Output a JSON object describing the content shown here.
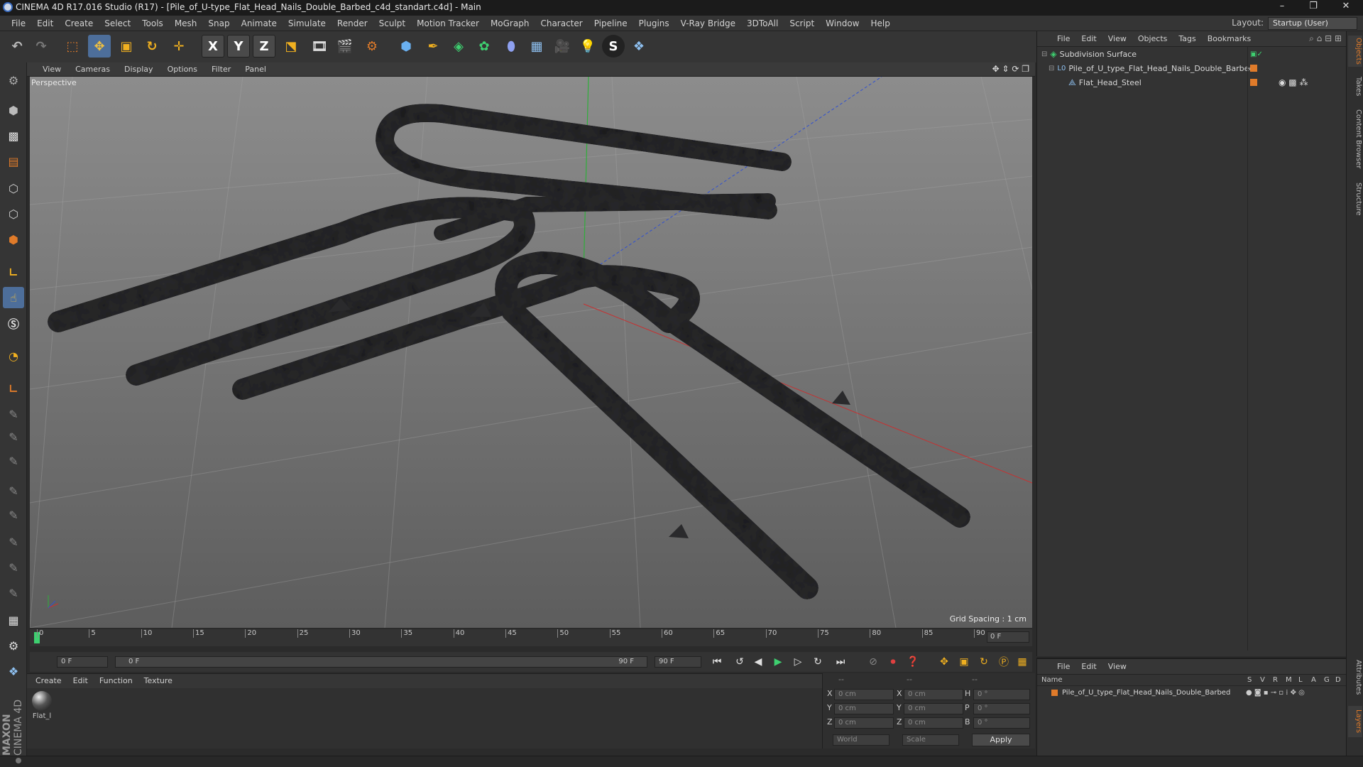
{
  "window": {
    "title": "CINEMA 4D R17.016 Studio (R17) - [Pile_of_U-type_Flat_Head_Nails_Double_Barbed_c4d_standart.c4d] - Main",
    "minimize": "–",
    "maximize": "❐",
    "close": "✕"
  },
  "menu": [
    "File",
    "Edit",
    "Create",
    "Select",
    "Tools",
    "Mesh",
    "Snap",
    "Animate",
    "Simulate",
    "Render",
    "Sculpt",
    "Motion Tracker",
    "MoGraph",
    "Character",
    "Pipeline",
    "Plugins",
    "V-Ray Bridge",
    "3DToAll",
    "Script",
    "Window",
    "Help"
  ],
  "layout": {
    "label": "Layout:",
    "value": "Startup (User)"
  },
  "toolbar": {
    "x": "X",
    "y": "Y",
    "z": "Z"
  },
  "viewport": {
    "menu": [
      "View",
      "Cameras",
      "Display",
      "Options",
      "Filter",
      "Panel"
    ],
    "label": "Perspective",
    "grid_spacing": "Grid Spacing : 1 cm"
  },
  "timeline": {
    "ticks": [
      "0",
      "5",
      "10",
      "15",
      "20",
      "25",
      "30",
      "35",
      "40",
      "45",
      "50",
      "55",
      "60",
      "65",
      "70",
      "75",
      "80",
      "85",
      "90"
    ],
    "frame_display": "0 F"
  },
  "playback": {
    "start": "0 F",
    "slider_start": "0 F",
    "slider_end": "90 F",
    "end": "90 F"
  },
  "material": {
    "menu": [
      "Create",
      "Edit",
      "Function",
      "Texture"
    ],
    "item": "Flat_l"
  },
  "coords": {
    "header": [
      "--",
      "--",
      "--"
    ],
    "rows": [
      {
        "a": "X",
        "av": "0 cm",
        "b": "X",
        "bv": "0 cm",
        "c": "H",
        "cv": "0 °"
      },
      {
        "a": "Y",
        "av": "0 cm",
        "b": "Y",
        "bv": "0 cm",
        "c": "P",
        "cv": "0 °"
      },
      {
        "a": "Z",
        "av": "0 cm",
        "b": "Z",
        "bv": "0 cm",
        "c": "B",
        "cv": "0 °"
      }
    ],
    "world": "World",
    "scale": "Scale",
    "apply": "Apply"
  },
  "objects": {
    "menu": [
      "File",
      "Edit",
      "View",
      "Objects",
      "Tags",
      "Bookmarks"
    ],
    "items": [
      {
        "name": "Subdivision Surface"
      },
      {
        "name": "Pile_of_U_type_Flat_Head_Nails_Double_Barbed"
      },
      {
        "name": "Flat_Head_Steel"
      }
    ]
  },
  "layers": {
    "menu": [
      "File",
      "Edit",
      "View"
    ],
    "columns": [
      "Name",
      "S",
      "V",
      "R",
      "M",
      "L",
      "A",
      "G",
      "D"
    ],
    "item": "Pile_of_U_type_Flat_Head_Nails_Double_Barbed"
  },
  "right_tabs": [
    "Objects",
    "Takes",
    "Content Browser",
    "Structure",
    "Attributes",
    "Layers"
  ],
  "branding": {
    "maxon": "MAXON",
    "cinema": "CINEMA 4D"
  },
  "colors": {
    "accent": "#e07b2a",
    "axis_x": "#c83030",
    "axis_y": "#2fae3a",
    "axis_z": "#3050d0"
  }
}
